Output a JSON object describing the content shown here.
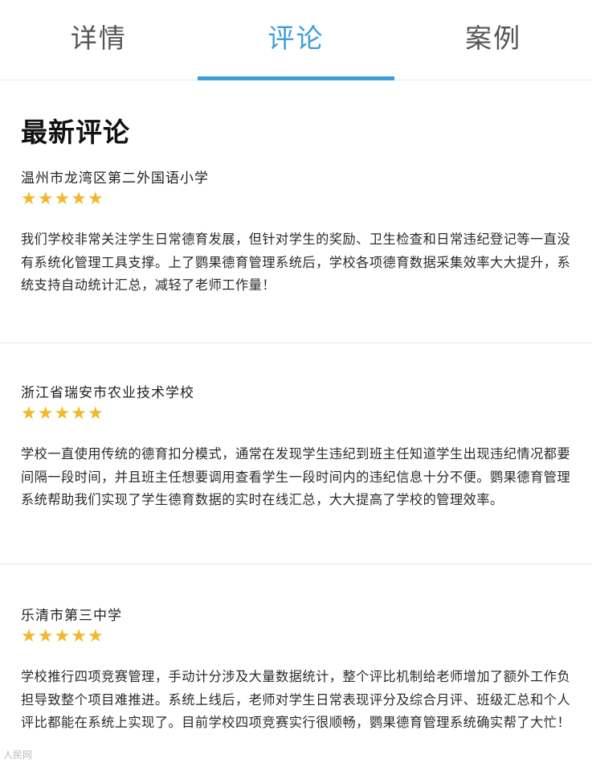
{
  "tabs": [
    {
      "label": "详情",
      "active": false
    },
    {
      "label": "评论",
      "active": true
    },
    {
      "label": "案例",
      "active": false
    }
  ],
  "section_title": "最新评论",
  "star_color": "#f3b72a",
  "accent_color": "#3d9fd9",
  "reviews": [
    {
      "name": "温州市龙湾区第二外国语小学",
      "rating": 5,
      "text": "我们学校非常关注学生日常德育发展，但针对学生的奖励、卫生检查和日常违纪登记等一直没有系统化管理工具支撑。上了鹦果德育管理系统后，学校各项德育数据采集效率大大提升，系统支持自动统计汇总，减轻了老师工作量！"
    },
    {
      "name": "浙江省瑞安市农业技术学校",
      "rating": 5,
      "text": "学校一直使用传统的德育扣分模式，通常在发现学生违纪到班主任知道学生出现违纪情况都要间隔一段时间，并且班主任想要调用查看学生一段时间内的违纪信息十分不便。鹦果德育管理系统帮助我们实现了学生德育数据的实时在线汇总，大大提高了学校的管理效率。"
    },
    {
      "name": "乐清市第三中学",
      "rating": 5,
      "text": "学校推行四项竞赛管理，手动计分涉及大量数据统计，整个评比机制给老师增加了额外工作负担导致整个项目难推进。系统上线后，老师对学生日常表现评分及综合月评、班级汇总和个人评比都能在系统上实现了。目前学校四项竞赛实行很顺畅，鹦果德育管理系统确实帮了大忙！"
    }
  ],
  "watermark": "人民网"
}
